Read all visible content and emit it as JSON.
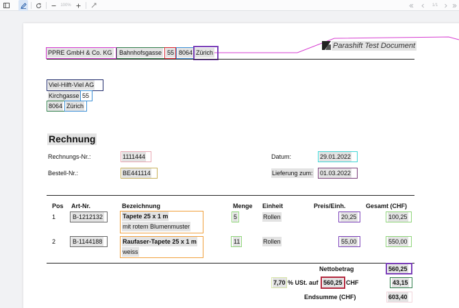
{
  "toolbar": {
    "zoom": "100%",
    "page": "1/1"
  },
  "header": {
    "company": "PPRE GmbH & Co. KG",
    "street": "Bahnhofsgasse",
    "number": "55",
    "zip": "8064",
    "city": "Zürich",
    "brand": "Parashift Test Document"
  },
  "recipient": {
    "name": "Viel-Hilft-Viel AG",
    "street": "Kirchgasse",
    "number": "55",
    "zip": "8064",
    "city": "Zürich"
  },
  "invoice": {
    "title": "Rechnung",
    "number_label": "Rechnungs-Nr.:",
    "number": "1111444",
    "order_label": "Bestell-Nr.:",
    "order": "BE441114",
    "date_label": "Datum:",
    "date": "29.01.2022",
    "delivery_label": "Lieferung zum:",
    "delivery": "01.03.2022"
  },
  "table": {
    "headers": [
      "Pos",
      "Art-Nr.",
      "Bezeichnung",
      "Menge",
      "Einheit",
      "Preis/Einh.",
      "Gesamt (CHF)"
    ],
    "rows": [
      {
        "pos": "1",
        "art": "B-1212132",
        "desc": "Tapete 25 x 1 m",
        "desc2": "mit rotem Blumenmuster",
        "qty": "5",
        "unit": "Rollen",
        "price": "20,25",
        "total": "100,25"
      },
      {
        "pos": "2",
        "art": "B-1144188",
        "desc": "Raufaser-Tapete 25 x 1 m",
        "desc2": "weiss",
        "qty": "11",
        "unit": "Rollen",
        "price": "55,00",
        "total": "550,00"
      }
    ]
  },
  "totals": {
    "net_label": "Nettobetrag",
    "net": "560,25",
    "vat_rate": "7,70",
    "vat_text": "% USt. auf",
    "vat_base": "560,25",
    "vat_currency": "CHF",
    "vat": "43,15",
    "sum_label": "Endsumme (CHF)",
    "sum": "603,40"
  },
  "colors": {
    "magenta": "#d63ad0",
    "green": "#2f7d4a",
    "red": "#d9232e",
    "blue": "#3a8fd6",
    "purple": "#7a3fb8",
    "navy": "#1e2a6b",
    "cyan": "#3fd6d6",
    "pink": "#e8a7b3",
    "orange": "#f0a03c",
    "lightgreen": "#8fd47a",
    "olive": "#c8b15a",
    "gray": "#666666"
  }
}
